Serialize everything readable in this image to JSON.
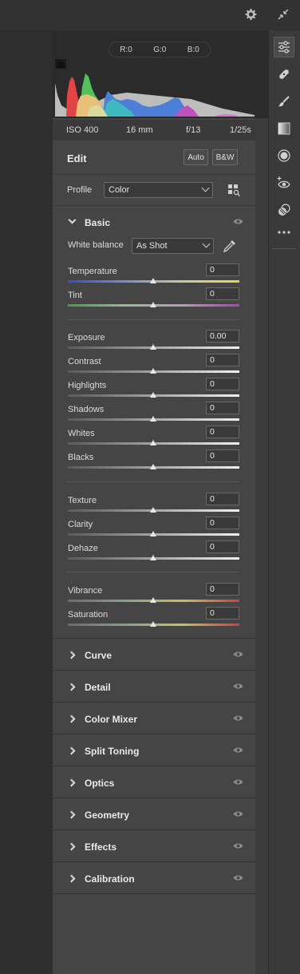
{
  "histogram": {
    "readout": {
      "r": "R:0",
      "g": "G:0",
      "b": "B:0"
    }
  },
  "exif": {
    "iso": "ISO 400",
    "focal": "16 mm",
    "aperture": "f/13",
    "shutter": "1/25s"
  },
  "edit": {
    "title": "Edit",
    "auto_label": "Auto",
    "bw_label": "B&W"
  },
  "profile": {
    "label": "Profile",
    "value": "Color"
  },
  "basic": {
    "title": "Basic",
    "white_balance": {
      "label": "White balance",
      "value": "As Shot"
    },
    "sliders": [
      {
        "label": "Temperature",
        "value": "0"
      },
      {
        "label": "Tint",
        "value": "0"
      },
      {
        "label": "Exposure",
        "value": "0.00"
      },
      {
        "label": "Contrast",
        "value": "0"
      },
      {
        "label": "Highlights",
        "value": "0"
      },
      {
        "label": "Shadows",
        "value": "0"
      },
      {
        "label": "Whites",
        "value": "0"
      },
      {
        "label": "Blacks",
        "value": "0"
      },
      {
        "label": "Texture",
        "value": "0"
      },
      {
        "label": "Clarity",
        "value": "0"
      },
      {
        "label": "Dehaze",
        "value": "0"
      },
      {
        "label": "Vibrance",
        "value": "0"
      },
      {
        "label": "Saturation",
        "value": "0"
      }
    ]
  },
  "sections": [
    {
      "title": "Curve"
    },
    {
      "title": "Detail"
    },
    {
      "title": "Color Mixer"
    },
    {
      "title": "Split Toning"
    },
    {
      "title": "Optics"
    },
    {
      "title": "Geometry"
    },
    {
      "title": "Effects"
    },
    {
      "title": "Calibration"
    }
  ],
  "icons": {
    "top": [
      "gear-icon",
      "collapse-icon"
    ],
    "tools": [
      "edit-sliders-icon",
      "healing-icon",
      "brush-icon",
      "graduated-filter-icon",
      "radial-filter-icon",
      "red-eye-icon",
      "presets-icon",
      "more-icon"
    ]
  },
  "colors": {
    "panel": "#454545",
    "background": "#3c3c3c",
    "accent": "#e6e6e6"
  }
}
